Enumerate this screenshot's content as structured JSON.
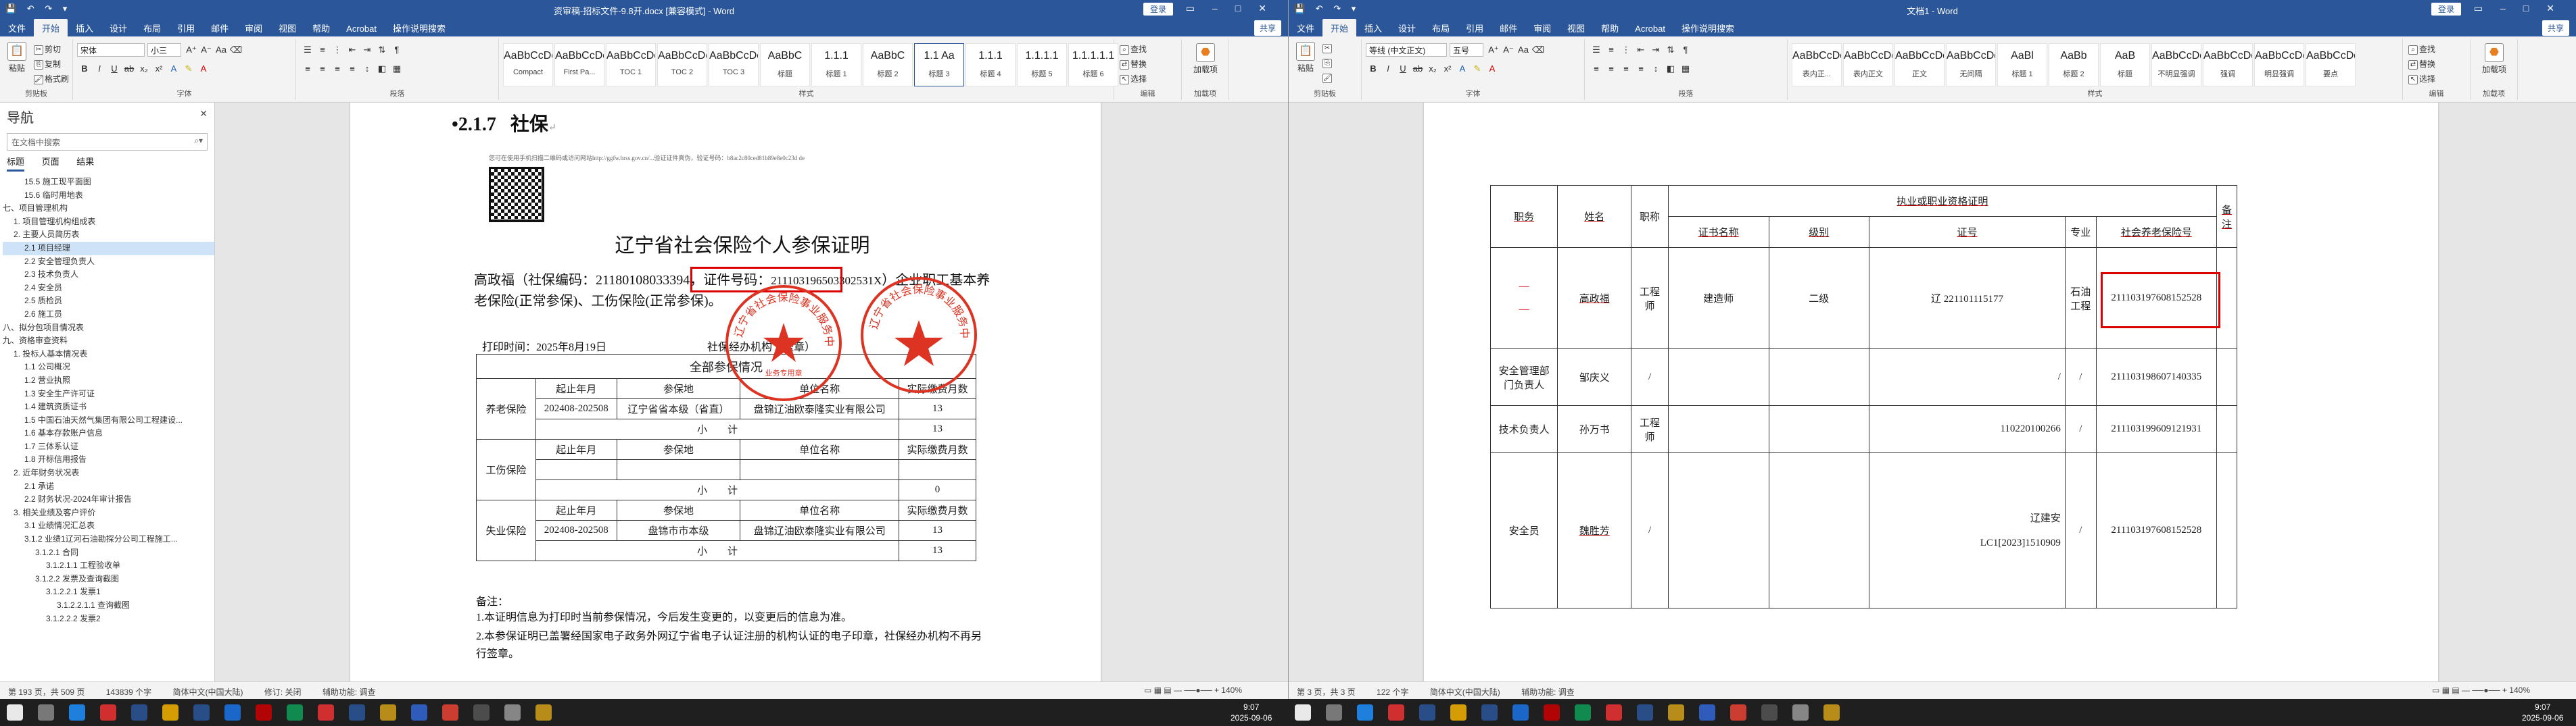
{
  "left": {
    "title": "资审稿-招标文件-9.8开.docx [兼容模式] - Word",
    "account": "登录",
    "tabs": [
      "文件",
      "开始",
      "插入",
      "设计",
      "布局",
      "引用",
      "邮件",
      "审阅",
      "视图",
      "帮助",
      "Acrobat"
    ],
    "tell_me": "操作说明搜索",
    "share": "共享",
    "ribbon": {
      "clipboard": {
        "paste": "粘贴",
        "cut": "剪切",
        "copy": "复制",
        "painter": "格式刷",
        "label": "剪贴板"
      },
      "font": {
        "name": "宋体",
        "size": "小三",
        "label": "字体"
      },
      "paragraph_label": "段落",
      "styles_label": "样式",
      "styles": [
        {
          "preview": "AaBbCcDc",
          "name": "Compact"
        },
        {
          "preview": "AaBbCcDc",
          "name": "First Pa..."
        },
        {
          "preview": "AaBbCcDc",
          "name": "TOC 1"
        },
        {
          "preview": "AaBbCcDc",
          "name": "TOC 2"
        },
        {
          "preview": "AaBbCcDc",
          "name": "TOC 3"
        },
        {
          "preview": "AaBbC",
          "name": "标题"
        },
        {
          "preview": "1.1.1",
          "name": "标题 1"
        },
        {
          "preview": "AaBbC",
          "name": "标题 2"
        },
        {
          "preview": "1.1 Aa",
          "name": "标题 3"
        },
        {
          "preview": "1.1.1",
          "name": "标题 4"
        },
        {
          "preview": "1.1.1.1",
          "name": "标题 5"
        },
        {
          "preview": "1.1.1.1.1",
          "name": "标题 6"
        }
      ],
      "editing": {
        "find": "查找",
        "replace": "替换",
        "select": "选择",
        "label": "编辑"
      },
      "addin": {
        "btn": "加载项",
        "label": "加载项"
      }
    },
    "nav": {
      "title": "导航",
      "search_placeholder": "在文档中搜索",
      "tabs": [
        "标题",
        "页面",
        "结果"
      ],
      "items": [
        "15.5 施工现平面图",
        "15.6 临时用地表",
        "七、项目管理机构",
        "1. 项目管理机构组成表",
        "2. 主要人员简历表",
        "2.1 项目经理",
        "2.2 安全管理负责人",
        "2.3 技术负责人",
        "2.4 安全员",
        "2.5 质检员",
        "2.6 施工员",
        "八、拟分包项目情况表",
        "九、资格审查资料",
        "1. 投标人基本情况表",
        "1.1 公司概况",
        "1.2 营业执照",
        "1.3 安全生产许可证",
        "1.4 建筑资质证书",
        "1.5 中国石油天然气集团有限公司工程建设...",
        "1.6 基本存款账户信息",
        "1.7 三体系认证",
        "1.8 开标信用报告",
        "2. 近年财务状况表",
        "2.1 承诺",
        "2.2 财务状况-2024年审计报告",
        "3. 相关业绩及客户评价",
        "3.1 业绩情况汇总表",
        "3.1.2 业绩1辽河石油勘探分公司工程施工...",
        "3.1.2.1 合同",
        "3.1.2.1.1 工程验收单",
        "3.1.2.2 发票及查询截图",
        "3.1.2.2.1 发票1",
        "3.1.2.2.1.1 查询截图",
        "3.1.2.2.2 发票2"
      ]
    },
    "doc": {
      "heading_num": "2.1.7",
      "heading_text": "社保",
      "verify_note": "您可在使用手机扫描二维码或访问网站http://ggfw.hrss.gov.cn/...验证证件真伪，验证号码：b8ac2c80ced81b89e8e0c23d de",
      "cert_title": "辽宁省社会保险个人参保证明",
      "body_p1": "高政福（社保编码：21180108033394，证件号码：",
      "id_number": "211103196503302531X",
      "body_p2": "）企业职工基本养老保险(正常参保)、工伤保险(正常参保)。",
      "print_time": "打印时间：2025年8月19日",
      "agency": "社保经办机构（盖章）",
      "table_title": "全部参保情况",
      "col_start": "起止年月",
      "col_place": "参保地",
      "col_unit": "单位名称",
      "col_months": "实际缴费月数",
      "subtotal": "小　　计",
      "pension": "养老保险",
      "injury": "工伤保险",
      "unemployment": "失业保险",
      "rows": [
        {
          "period": "202408-202508",
          "place": "辽宁省省本级（省直）",
          "unit": "盘锦辽油欧泰隆实业有限公司",
          "months": "13"
        },
        {
          "subtotal": "13"
        },
        {
          "period": "",
          "place": "",
          "unit": "",
          "months": ""
        },
        {
          "subtotal": "0"
        },
        {
          "period": "202408-202508",
          "place": "盘锦市市本级",
          "unit": "盘锦辽油欧泰隆实业有限公司",
          "months": "13"
        },
        {
          "subtotal": "13"
        }
      ],
      "remark_title": "备注：",
      "remarks": [
        "1.本证明信息为打印时当前参保情况，今后发生变更的，以变更后的信息为准。",
        "2.本参保证明已盖署经国家电子政务外网辽宁省电子认证注册的机构认证的电子印章，社保经办机构不再另行签章。"
      ],
      "stamp1_text": "辽宁省社会保险事业服务中心",
      "stamp2_text": "辽宁省社会保险事业服务中心",
      "stamp_inner": "业务专用章"
    },
    "status": {
      "page": "第 193 页，共 509 页",
      "words": "143839 个字",
      "lang": "简体中文(中国大陆)",
      "track": "修订: 关闭",
      "access": "辅助功能: 调查",
      "zoom": "140%"
    }
  },
  "right": {
    "title": "文档1 - Word",
    "account": "登录",
    "tabs": [
      "文件",
      "开始",
      "插入",
      "设计",
      "布局",
      "引用",
      "邮件",
      "审阅",
      "视图",
      "帮助",
      "Acrobat"
    ],
    "tell_me": "操作说明搜索",
    "share": "共享",
    "ribbon": {
      "clipboard": {
        "paste": "粘贴",
        "label": "剪贴板"
      },
      "font": {
        "name": "等线 (中文正文)",
        "size": "五号",
        "label": "字体"
      },
      "paragraph_label": "段落",
      "styles_label": "样式",
      "styles": [
        {
          "preview": "AaBbCcDd",
          "name": "表内正..."
        },
        {
          "preview": "AaBbCcDd",
          "name": "表内正文"
        },
        {
          "preview": "AaBbCcDd",
          "name": "正文"
        },
        {
          "preview": "AaBbCcDd",
          "name": "无间隔"
        },
        {
          "preview": "AaBl",
          "name": "标题 1"
        },
        {
          "preview": "AaBb",
          "name": "标题 2"
        },
        {
          "preview": "AaB",
          "name": "标题"
        },
        {
          "preview": "AaBbCcDd",
          "name": "不明显强调"
        },
        {
          "preview": "AaBbCcDd",
          "name": "强调"
        },
        {
          "preview": "AaBbCcDd",
          "name": "明显强调"
        },
        {
          "preview": "AaBbCcDd",
          "name": "要点"
        }
      ],
      "editing": {
        "find": "查找",
        "replace": "替换",
        "select": "选择",
        "label": "编辑"
      },
      "addin": {
        "btn": "加载项",
        "label": "加载项"
      }
    },
    "table": {
      "h_position": "职务",
      "h_name": "姓名",
      "h_title": "职称",
      "h_cert_group": "执业或职业资格证明",
      "h_cert_name": "证书名称",
      "h_level": "级别",
      "h_cert_no": "证号",
      "h_major": "专业",
      "h_ss_no": "社会养老保险号",
      "h_note": "备注",
      "rows": [
        {
          "position": "",
          "name": "高政福",
          "title": "工程师",
          "cert_name": "建造师",
          "level": "二级",
          "cert_no": "辽 221101115177",
          "major": "石油工程",
          "ss_no": "211103197608152528"
        },
        {
          "position": "安全管理部门负责人",
          "name": "邹庆义",
          "title": "/",
          "cert_name": "",
          "level": "",
          "cert_no": "/",
          "major": "/",
          "ss_no": "211103198607140335"
        },
        {
          "position": "技术负责人",
          "name": "孙万书",
          "title": "工程师",
          "cert_name": "",
          "level": "",
          "cert_no": "110220100266",
          "major": "/",
          "ss_no": "211103199609121931"
        },
        {
          "position": "安全员",
          "name": "魏胜芳",
          "title": "/",
          "cert_name": "",
          "level": "",
          "cert_no": "辽建安 LC1[2023]1510909",
          "major": "/",
          "ss_no": "211103197608152528"
        }
      ]
    },
    "status": {
      "page": "第 3 页，共 3 页",
      "words": "122 个字",
      "lang": "简体中文(中国大陆)",
      "access": "辅助功能: 调查",
      "zoom": "140%"
    }
  },
  "clock": {
    "time": "9:07",
    "date": "2025-09-06"
  },
  "colors": {
    "word_blue": "#2b579a",
    "stamp_red": "#d32f2f",
    "highlight_red": "#dd0000"
  }
}
